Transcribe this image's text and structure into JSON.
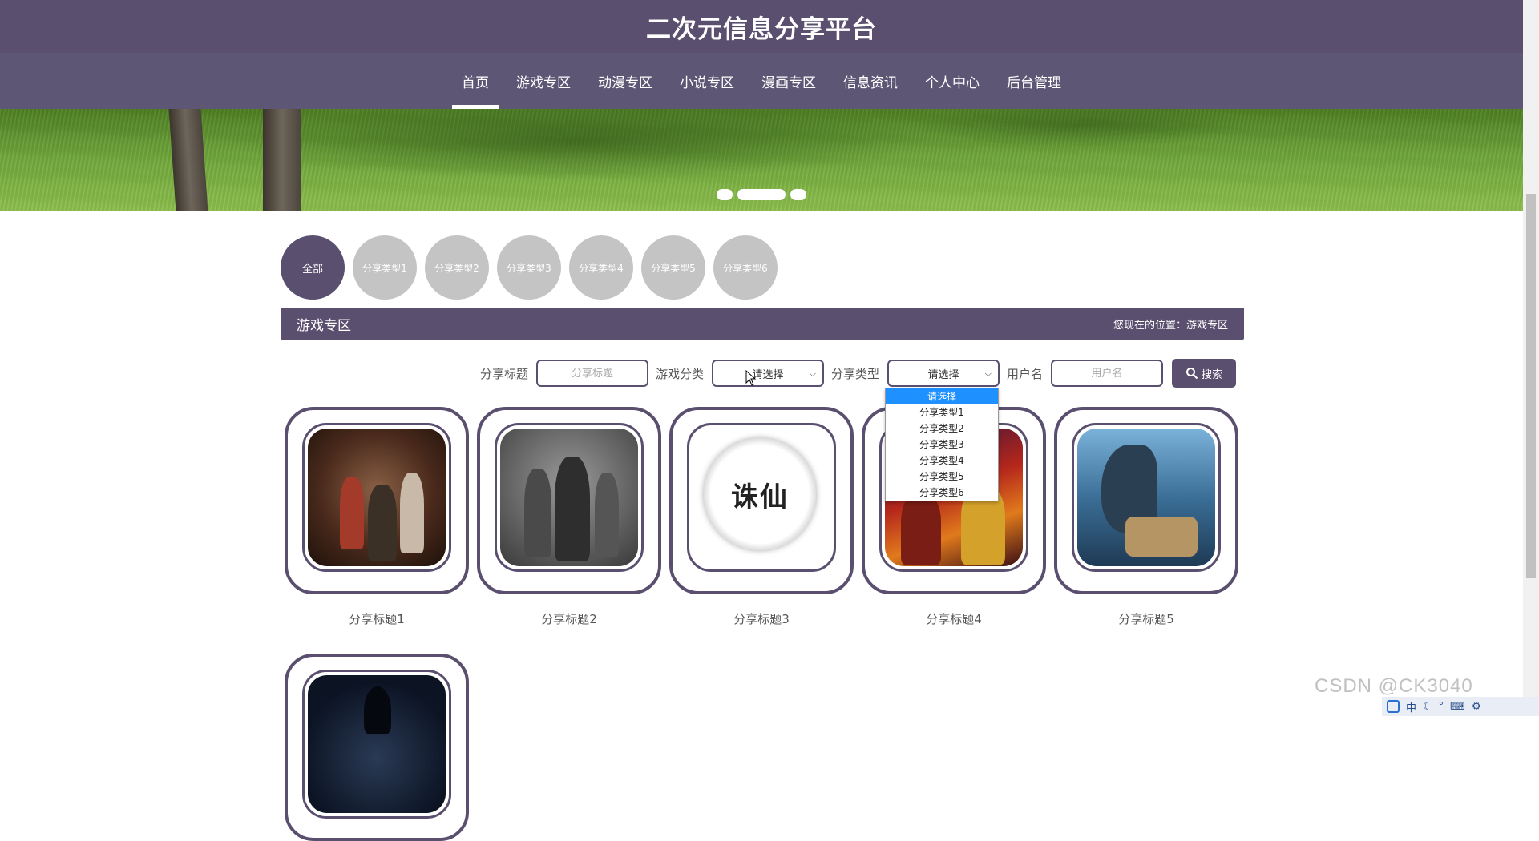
{
  "site": {
    "title": "二次元信息分享平台"
  },
  "nav": {
    "items": [
      {
        "label": "首页",
        "active": true
      },
      {
        "label": "游戏专区",
        "active": false
      },
      {
        "label": "动漫专区",
        "active": false
      },
      {
        "label": "小说专区",
        "active": false
      },
      {
        "label": "漫画专区",
        "active": false
      },
      {
        "label": "信息资讯",
        "active": false
      },
      {
        "label": "个人中心",
        "active": false
      },
      {
        "label": "后台管理",
        "active": false
      }
    ]
  },
  "banner": {
    "slide_count": 3,
    "active_slide": 2
  },
  "categories": [
    {
      "label": "全部",
      "active": true
    },
    {
      "label": "分享类型1",
      "active": false
    },
    {
      "label": "分享类型2",
      "active": false
    },
    {
      "label": "分享类型3",
      "active": false
    },
    {
      "label": "分享类型4",
      "active": false
    },
    {
      "label": "分享类型5",
      "active": false
    },
    {
      "label": "分享类型6",
      "active": false
    }
  ],
  "section": {
    "title": "游戏专区",
    "breadcrumb": "您现在的位置：游戏专区"
  },
  "search": {
    "title_label": "分享标题",
    "title_placeholder": "分享标题",
    "game_category_label": "游戏分类",
    "game_category_value": "请选择",
    "share_type_label": "分享类型",
    "share_type_value": "请选择",
    "username_label": "用户名",
    "username_placeholder": "用户名",
    "button_label": "搜索"
  },
  "dropdown": {
    "options": [
      "请选择",
      "分享类型1",
      "分享类型2",
      "分享类型3",
      "分享类型4",
      "分享类型5",
      "分享类型6"
    ],
    "selected_index": 0
  },
  "cards": [
    {
      "title": "分享标题1"
    },
    {
      "title": "分享标题2"
    },
    {
      "title": "分享标题3"
    },
    {
      "title": "分享标题4"
    },
    {
      "title": "分享标题5"
    },
    {
      "title": ""
    }
  ],
  "card3_logo_text": "诛仙",
  "watermark": "CSDN @CK3040",
  "tray": {
    "ime": "中"
  },
  "colors": {
    "primary": "#5a4f6e",
    "nav": "#5e5675",
    "category_inactive": "#c4c4c4",
    "dropdown_selected": "#1e90ff"
  }
}
